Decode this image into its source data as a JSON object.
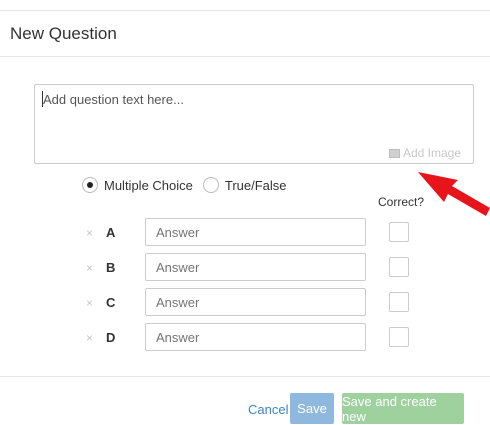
{
  "header": {
    "title": "New Question"
  },
  "question": {
    "placeholder": "Add question text here...",
    "add_image_label": "Add Image"
  },
  "types": {
    "options": [
      {
        "label": "Multiple Choice",
        "selected": true
      },
      {
        "label": "True/False",
        "selected": false
      }
    ]
  },
  "answers": {
    "correct_label": "Correct?",
    "remove_icon": "×",
    "rows": [
      {
        "letter": "A",
        "placeholder": "Answer"
      },
      {
        "letter": "B",
        "placeholder": "Answer"
      },
      {
        "letter": "C",
        "placeholder": "Answer"
      },
      {
        "letter": "D",
        "placeholder": "Answer"
      }
    ]
  },
  "footer": {
    "cancel_label": "Cancel",
    "save_label": "Save",
    "save_new_label": "Save and create new"
  },
  "colors": {
    "arrow": "#e8141b",
    "link": "#3a86c4",
    "save_button": "#8fb8de",
    "save_new_button": "#9fd19f"
  },
  "icons": {
    "arrow": "red-arrow-icon",
    "image": "image-icon",
    "remove": "close-icon"
  }
}
